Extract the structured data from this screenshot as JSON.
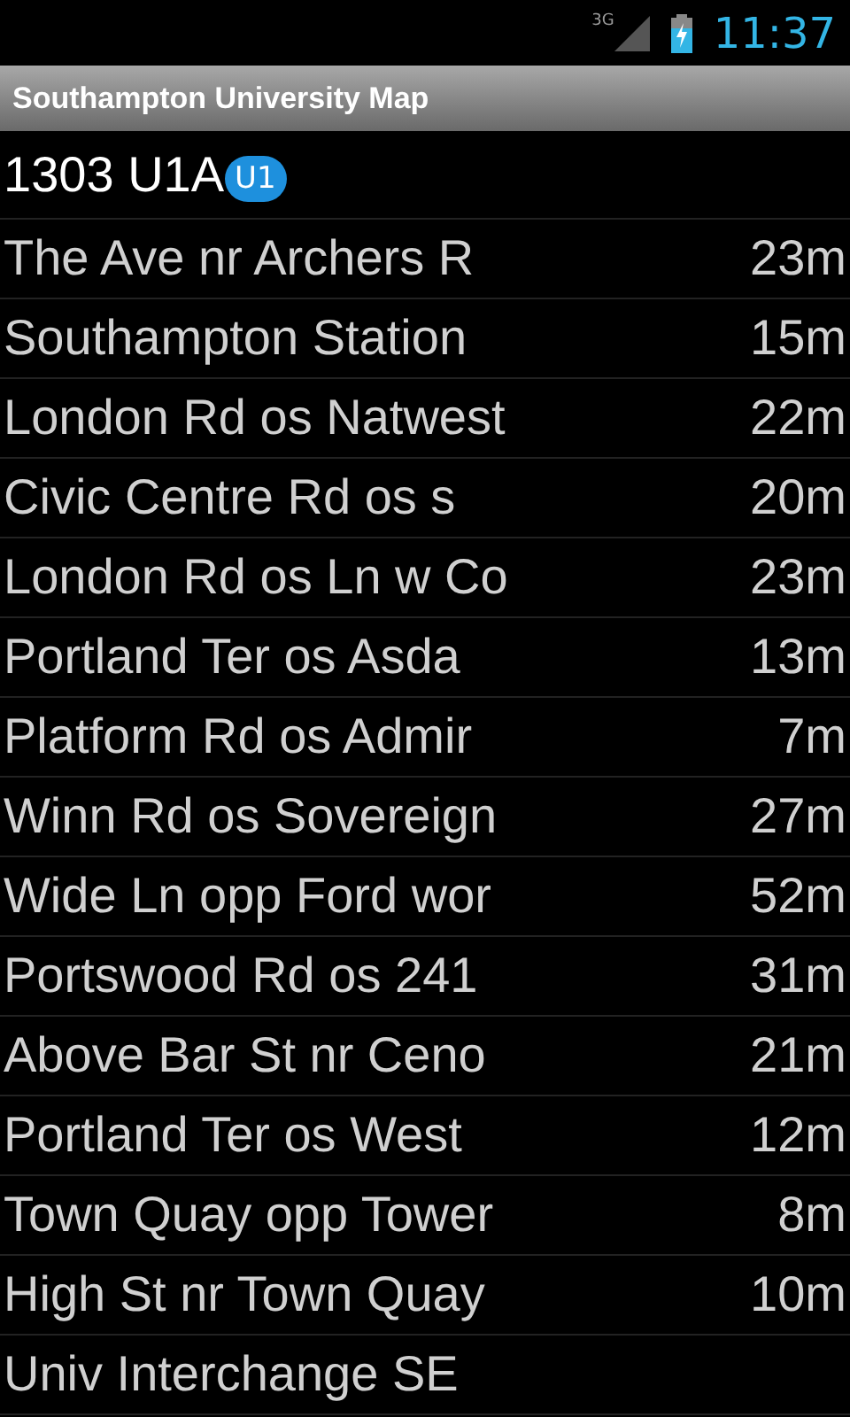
{
  "status_bar": {
    "network": "3G",
    "time": "11:37"
  },
  "app_bar": {
    "title": "Southampton University Map"
  },
  "stop": {
    "title": "1303 U1A",
    "badge": "U1"
  },
  "departures": [
    {
      "stop": "The Ave nr Archers R",
      "time": "23m"
    },
    {
      "stop": "Southampton Station",
      "time": "15m"
    },
    {
      "stop": "London Rd os Natwest",
      "time": "22m"
    },
    {
      "stop": "Civic Centre Rd os s",
      "time": "20m"
    },
    {
      "stop": "London Rd os Ln w Co",
      "time": "23m"
    },
    {
      "stop": "Portland Ter os Asda",
      "time": "13m"
    },
    {
      "stop": "Platform Rd os Admir",
      "time": "7m"
    },
    {
      "stop": "Winn Rd os Sovereign",
      "time": "27m"
    },
    {
      "stop": "Wide Ln opp Ford wor",
      "time": "52m"
    },
    {
      "stop": "Portswood Rd os 241",
      "time": "31m"
    },
    {
      "stop": "Above Bar St nr Ceno",
      "time": "21m"
    },
    {
      "stop": "Portland Ter os West",
      "time": "12m"
    },
    {
      "stop": "Town Quay opp Tower",
      "time": "8m"
    },
    {
      "stop": "High St nr Town Quay",
      "time": "10m"
    },
    {
      "stop": "Univ Interchange SE"
    }
  ]
}
